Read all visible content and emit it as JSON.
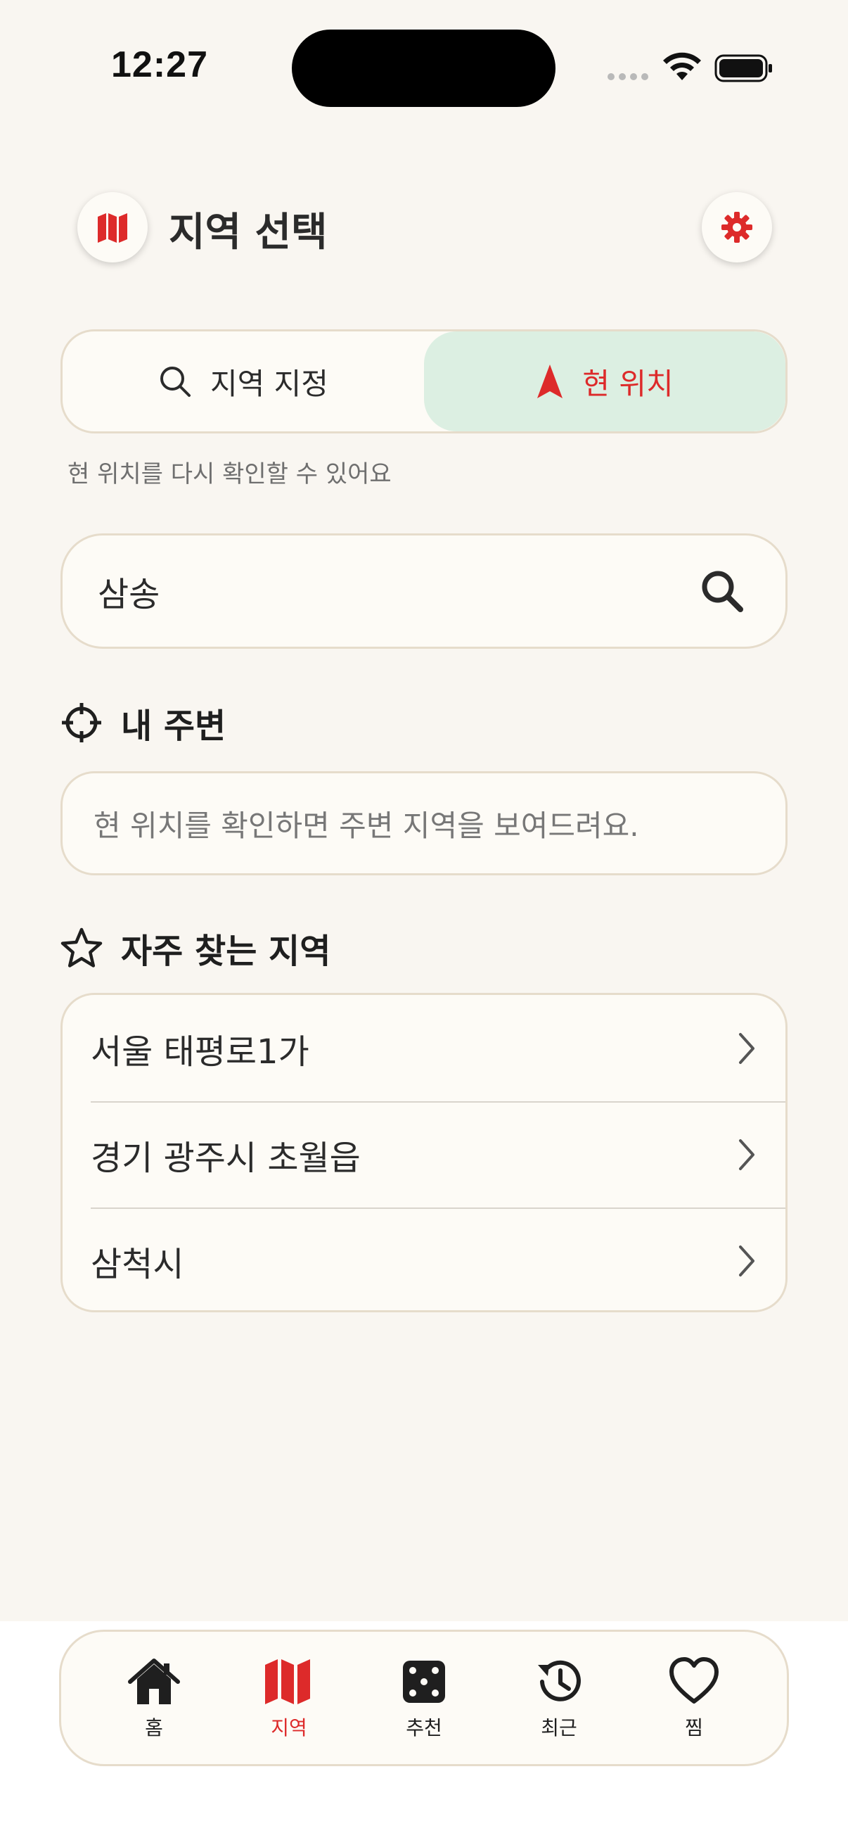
{
  "status": {
    "time": "12:27"
  },
  "header": {
    "title": "지역 선택"
  },
  "segment": {
    "left_label": "지역 지정",
    "right_label": "현 위치"
  },
  "hint": "현 위치를 다시 확인할 수 있어요",
  "search": {
    "value": "삼송"
  },
  "nearby": {
    "heading": "내 주변",
    "message": "현 위치를 확인하면 주변 지역을 보여드려요."
  },
  "favorites": {
    "heading": "자주 찾는 지역",
    "items": [
      {
        "label": "서울 태평로1가"
      },
      {
        "label": "경기 광주시 초월읍"
      },
      {
        "label": "삼척시"
      }
    ]
  },
  "tabbar": {
    "items": [
      {
        "label": "홈",
        "icon": "house-icon"
      },
      {
        "label": "지역",
        "icon": "map-icon"
      },
      {
        "label": "추천",
        "icon": "dice-icon"
      },
      {
        "label": "최근",
        "icon": "history-icon"
      },
      {
        "label": "찜",
        "icon": "heart-icon"
      }
    ],
    "active": "지역"
  },
  "colors": {
    "accent": "#dd2a2a",
    "selected_bg": "#dcefe2",
    "background": "#f9f6f1",
    "card": "#fdfbf6",
    "border": "#e6dccb"
  }
}
